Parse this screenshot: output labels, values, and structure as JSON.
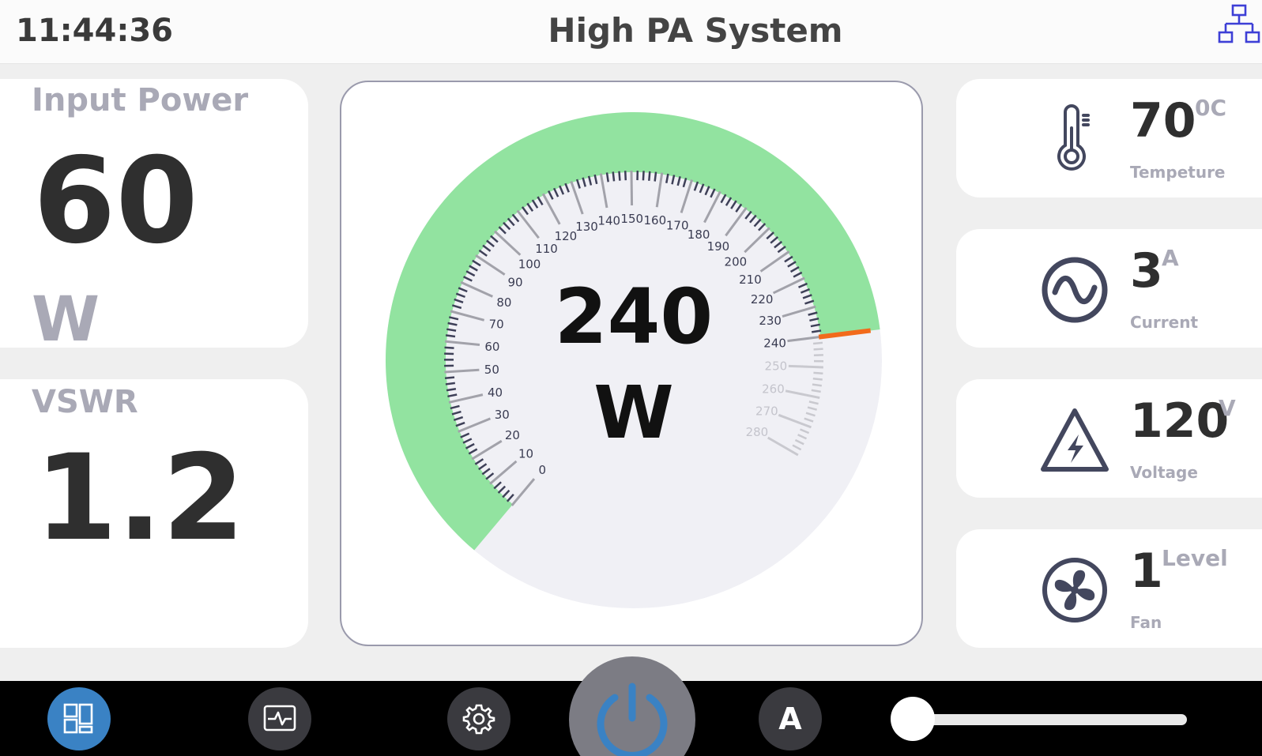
{
  "header": {
    "time": "11:44:36",
    "title": "High PA System",
    "network_icon": "network-icon"
  },
  "input_power": {
    "label": "Input Power",
    "value": "60",
    "unit": "W"
  },
  "vswr": {
    "label": "VSWR",
    "value": "1.2"
  },
  "gauge": {
    "value": 240,
    "value_text": "240",
    "unit": "W",
    "min": 0,
    "max": 280,
    "ticks": [
      "0",
      "10",
      "20",
      "30",
      "40",
      "50",
      "60",
      "70",
      "80",
      "90",
      "100",
      "110",
      "120",
      "130",
      "140",
      "150",
      "160",
      "170",
      "180",
      "190",
      "200",
      "210",
      "220",
      "230",
      "240",
      "250",
      "260",
      "270",
      "280"
    ],
    "arc_color": "#92e3a0",
    "needle_color": "#f26a1b"
  },
  "stats": [
    {
      "icon": "thermometer-icon",
      "value": "70",
      "unit": "0C",
      "label": "Tempeture"
    },
    {
      "icon": "sine-wave-icon",
      "value": "3",
      "unit": "A",
      "label": "Current"
    },
    {
      "icon": "high-voltage-icon",
      "value": "120",
      "unit": "V",
      "label": "Voltage"
    },
    {
      "icon": "fan-icon",
      "value": "1",
      "unit": "Level",
      "label": "Fan"
    }
  ],
  "bottom_bar": {
    "dashboard_icon": "dashboard-icon",
    "monitor_icon": "monitor-icon",
    "settings_icon": "gear-icon",
    "power_icon": "power-icon",
    "auto_label": "A",
    "slider_value": 0
  },
  "colors": {
    "accent": "#3a82c4",
    "label_gray": "#a9a9b6",
    "icon_navy": "#43475e"
  }
}
